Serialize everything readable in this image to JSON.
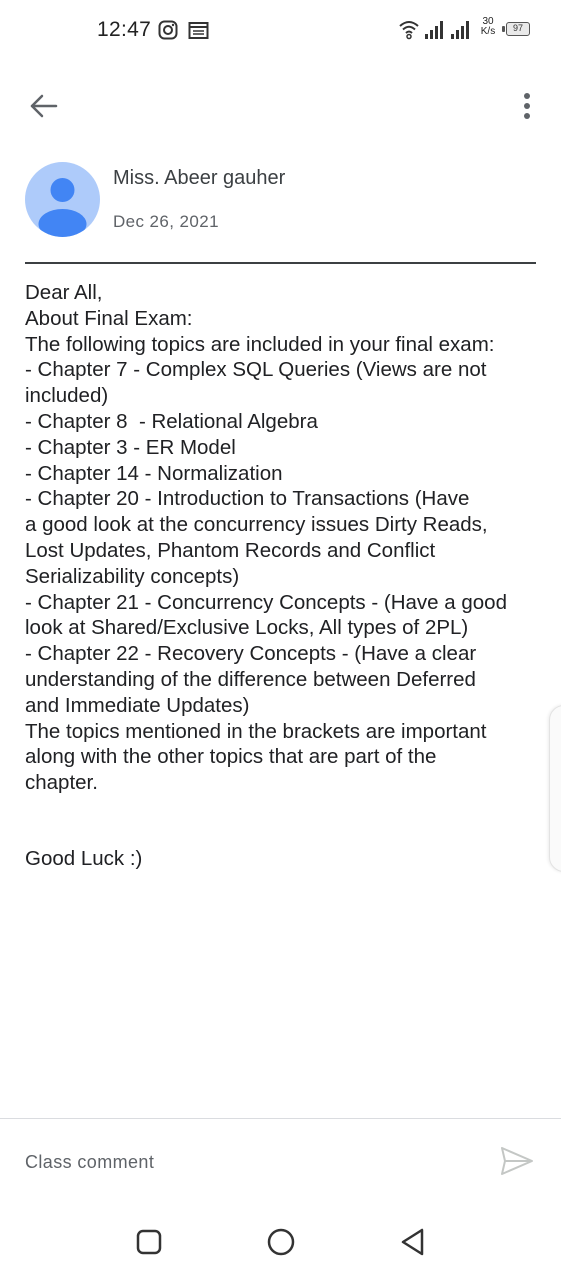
{
  "status_bar": {
    "time": "12:47",
    "net_speed_value": "30",
    "net_speed_unit": "K/s",
    "battery": "97",
    "icons": [
      "instagram-icon",
      "calendar-icon",
      "wifi-icon",
      "signal-icon",
      "signal-icon",
      "battery-icon"
    ]
  },
  "app_bar": {
    "back_icon": "arrow-left-icon",
    "menu_icon": "more-vert-icon"
  },
  "post": {
    "author": "Miss. Abeer gauher",
    "date": "Dec 26, 2021",
    "body_lines": [
      "Dear All,",
      "About Final Exam:",
      "The following topics are included in your final exam:",
      "- Chapter 7 - Complex SQL Queries (Views are not",
      "included)",
      "- Chapter 8  - Relational Algebra",
      "- Chapter 3 - ER Model",
      "- Chapter 14 - Normalization",
      "- Chapter 20 - Introduction to Transactions (Have",
      "a good look at the concurrency issues Dirty Reads,",
      "Lost Updates, Phantom Records and Conflict",
      "Serializability concepts)",
      "- Chapter 21 - Concurrency Concepts - (Have a good",
      "look at Shared/Exclusive Locks, All types of 2PL)",
      "- Chapter 22 - Recovery Concepts - (Have a clear",
      "understanding of the difference between Deferred",
      "and Immediate Updates)",
      "The topics mentioned in the brackets are important",
      "along with the other topics that are part of the",
      "chapter."
    ],
    "signoff": "Good Luck :)"
  },
  "comment": {
    "placeholder": "Class comment",
    "value": "",
    "send_icon": "send-icon"
  },
  "nav_bar": {
    "icons": [
      "recents-square-icon",
      "home-circle-icon",
      "back-triangle-icon"
    ]
  },
  "colors": {
    "avatar_bg": "#aecbfa",
    "avatar_fg": "#4285f4",
    "text": "#202124",
    "secondary_text": "#5f6368"
  }
}
